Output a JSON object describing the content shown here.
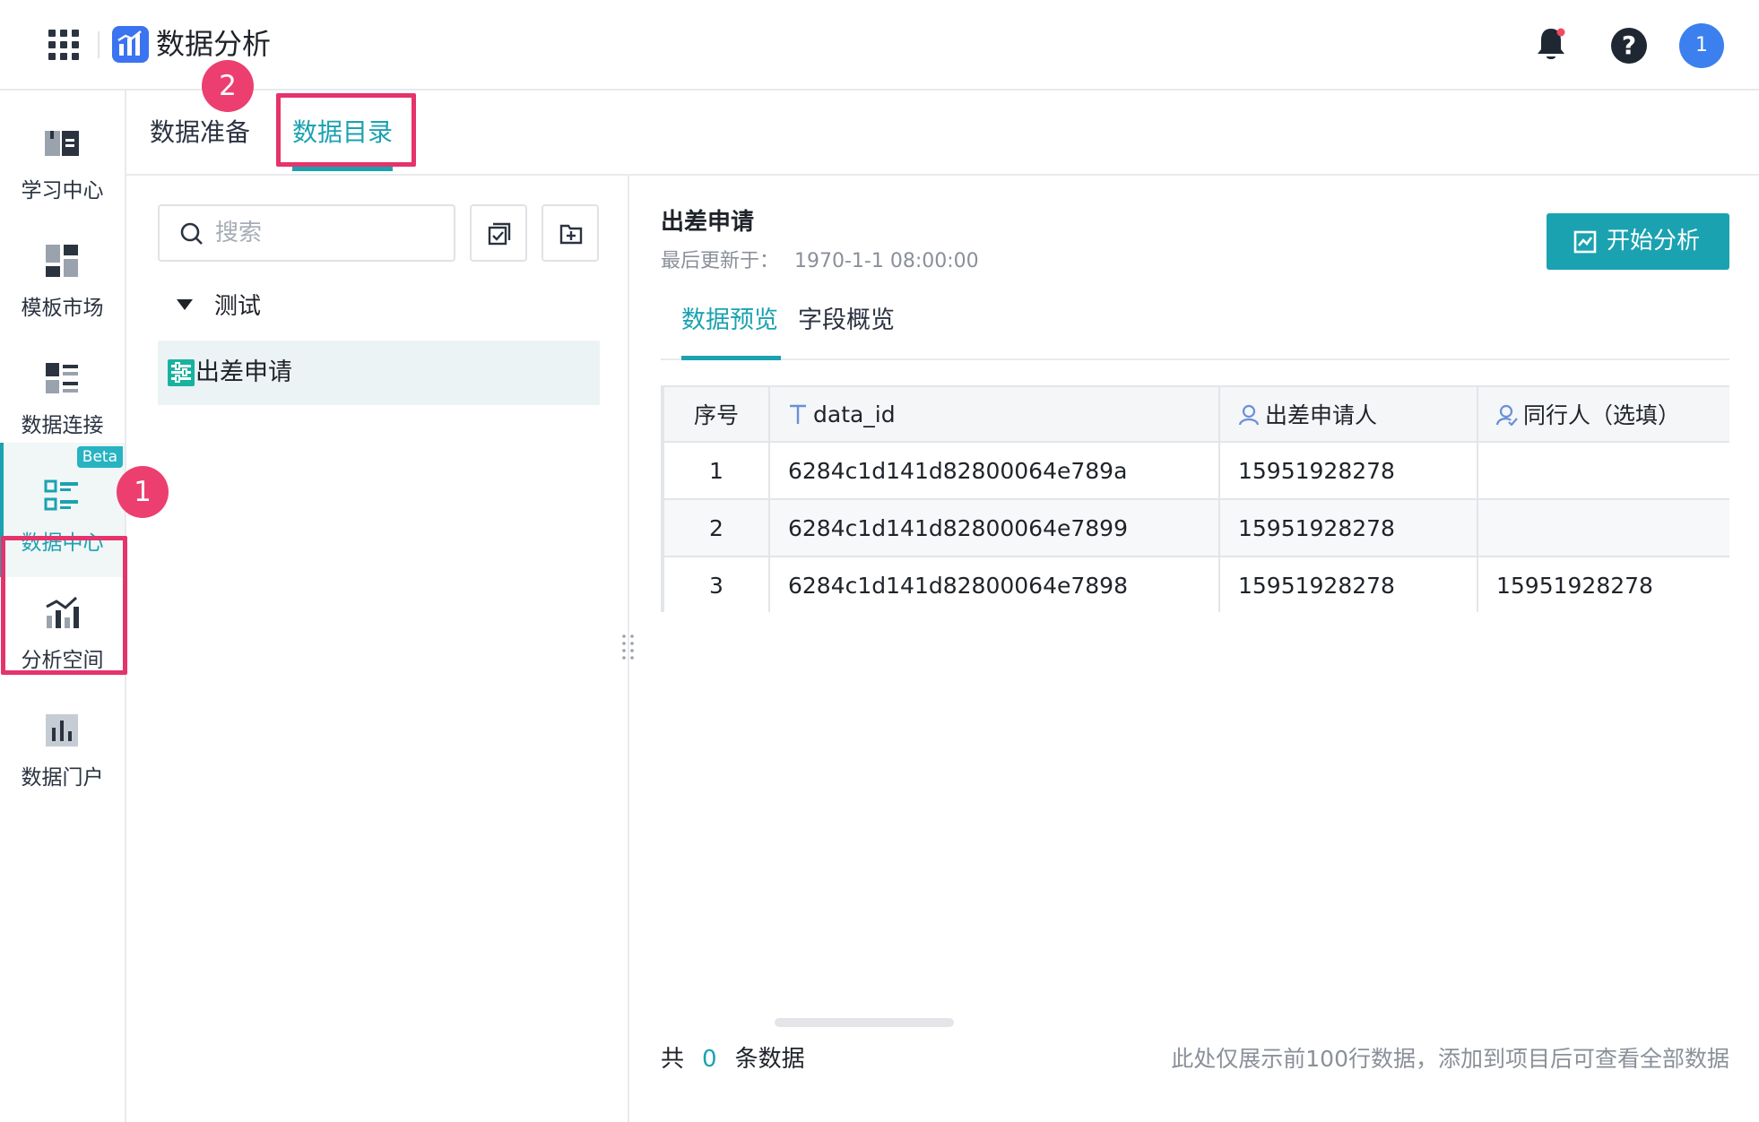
{
  "app": {
    "title": "数据分析",
    "avatar_text": "1"
  },
  "sidebar": {
    "items": [
      {
        "label": "学习中心",
        "icon": "book-icon"
      },
      {
        "label": "模板市场",
        "icon": "template-icon"
      },
      {
        "label": "数据连接",
        "icon": "data-connect-icon"
      },
      {
        "label": "数据中心",
        "icon": "data-center-icon",
        "badge": "Beta",
        "active": true
      },
      {
        "label": "分析空间",
        "icon": "analysis-icon"
      },
      {
        "label": "数据门户",
        "icon": "portal-icon"
      }
    ]
  },
  "subtabs": [
    {
      "label": "数据准备"
    },
    {
      "label": "数据目录",
      "active": true
    }
  ],
  "annotations": {
    "marker1": "1",
    "marker2": "2"
  },
  "tree": {
    "search_placeholder": "搜索",
    "folder": "测试",
    "leaf": "出差申请"
  },
  "detail": {
    "title": "出差申请",
    "updated_label": "最后更新于：",
    "updated_value": "1970-1-1 08:00:00",
    "analyze_button": "开始分析",
    "tabs": [
      {
        "label": "数据预览",
        "active": true
      },
      {
        "label": "字段概览"
      }
    ],
    "columns": [
      "序号",
      "data_id",
      "出差申请人",
      "同行人（选填）"
    ],
    "rows": [
      [
        "1",
        "6284c1d141d82800064e789a",
        "15951928278",
        ""
      ],
      [
        "2",
        "6284c1d141d82800064e7899",
        "15951928278",
        ""
      ],
      [
        "3",
        "6284c1d141d82800064e7898",
        "15951928278",
        "15951928278"
      ]
    ],
    "footer": {
      "prefix": "共",
      "count": "0",
      "suffix": "条数据",
      "note": "此处仅展示前100行数据，添加到项目后可查看全部数据"
    }
  },
  "colors": {
    "accent": "#1ba2b1",
    "annotation": "#e5336b",
    "logo": "#3b74f0"
  }
}
